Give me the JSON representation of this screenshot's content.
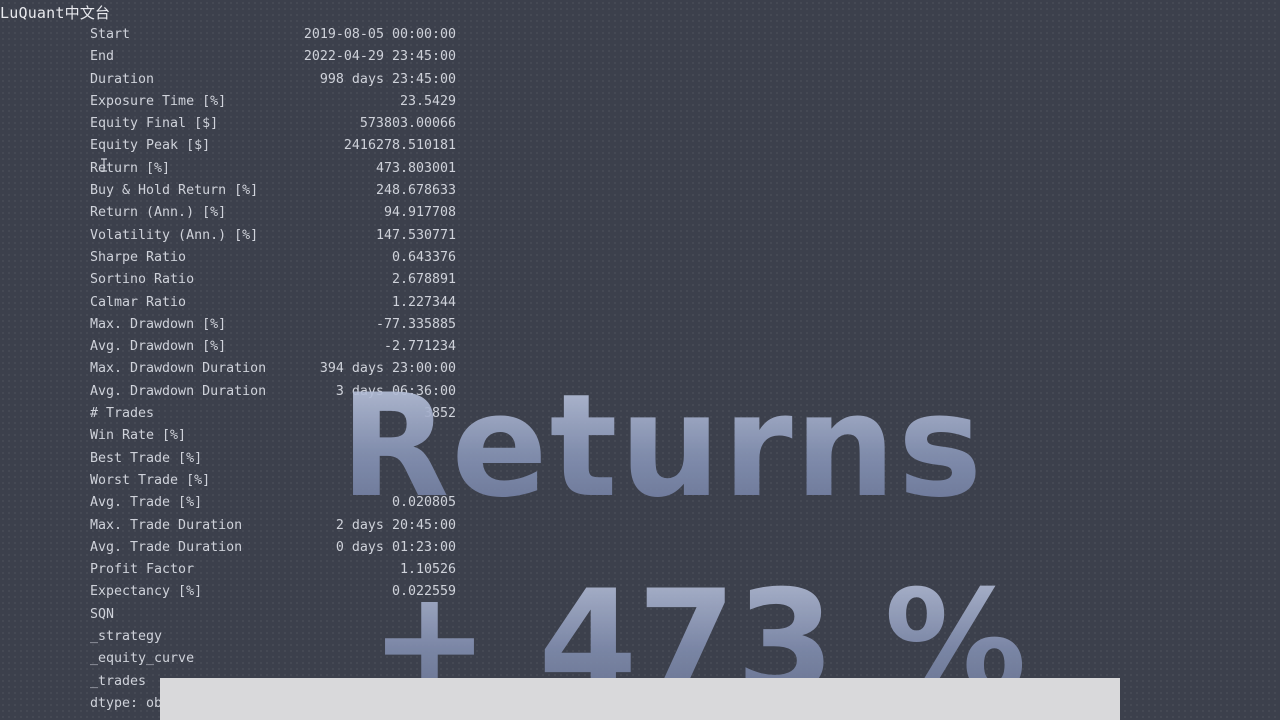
{
  "app": {
    "title": "LuQuant中文台"
  },
  "stats": [
    {
      "key": "Start",
      "value": "2019-08-05 00:00:00"
    },
    {
      "key": "End",
      "value": "2022-04-29 23:45:00"
    },
    {
      "key": "Duration",
      "value": "998 days 23:45:00"
    },
    {
      "key": "Exposure Time [%]",
      "value": "23.5429"
    },
    {
      "key": "Equity Final [$]",
      "value": "573803.00066"
    },
    {
      "key": "Equity Peak [$]",
      "value": "2416278.510181"
    },
    {
      "key": "Return [%]",
      "value": "473.803001"
    },
    {
      "key": "Buy & Hold Return [%]",
      "value": "248.678633"
    },
    {
      "key": "Return (Ann.) [%]",
      "value": "94.917708"
    },
    {
      "key": "Volatility (Ann.) [%]",
      "value": "147.530771"
    },
    {
      "key": "Sharpe Ratio",
      "value": "0.643376"
    },
    {
      "key": "Sortino Ratio",
      "value": "2.678891"
    },
    {
      "key": "Calmar Ratio",
      "value": "1.227344"
    },
    {
      "key": "Max. Drawdown [%]",
      "value": "-77.335885"
    },
    {
      "key": "Avg. Drawdown [%]",
      "value": "-2.771234"
    },
    {
      "key": "Max. Drawdown Duration",
      "value": "394 days 23:00:00"
    },
    {
      "key": "Avg. Drawdown Duration",
      "value": "3 days 06:36:00"
    },
    {
      "key": "# Trades",
      "value": "3852"
    },
    {
      "key": "Win Rate [%]",
      "value": ""
    },
    {
      "key": "Best Trade [%]",
      "value": ""
    },
    {
      "key": "Worst Trade [%]",
      "value": ""
    },
    {
      "key": "Avg. Trade [%]",
      "value": "0.020805"
    },
    {
      "key": "Max. Trade Duration",
      "value": "2 days 20:45:00"
    },
    {
      "key": "Avg. Trade Duration",
      "value": "0 days 01:23:00"
    },
    {
      "key": "Profit Factor",
      "value": "1.10526"
    },
    {
      "key": "Expectancy [%]",
      "value": "0.022559"
    },
    {
      "key": "SQN",
      "value": ""
    },
    {
      "key": "_strategy",
      "value": ""
    },
    {
      "key": "_equity_curve",
      "value": ""
    },
    {
      "key": "_trades",
      "value": ""
    },
    {
      "key": "dtype: ob",
      "value": ""
    }
  ],
  "overlay": {
    "headline": "Returns",
    "figure": "+ 473 %"
  },
  "colors": {
    "background": "#3c404c",
    "text": "#cfd2da",
    "overlay": "#9aa6c4",
    "bottom_bar": "#d9d9db"
  }
}
